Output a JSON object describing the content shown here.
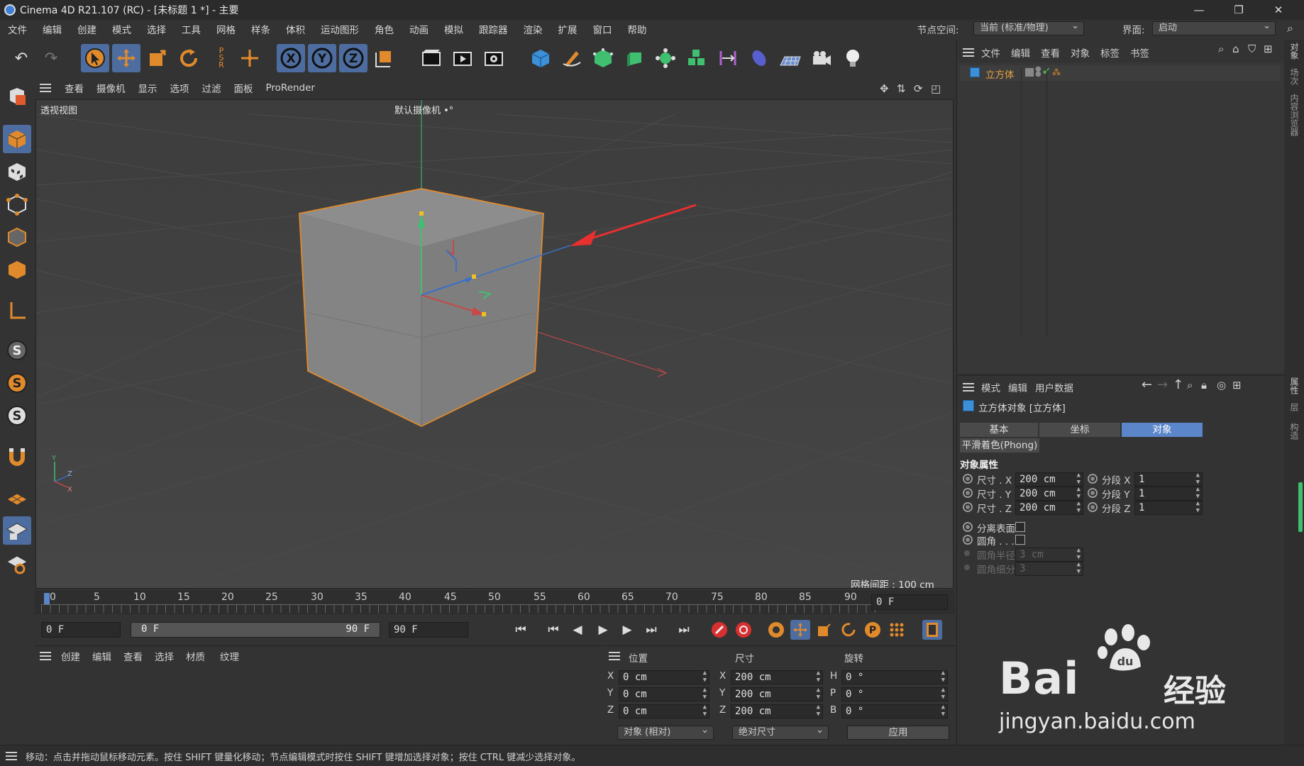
{
  "window": {
    "title": "Cinema 4D R21.107 (RC) - [未标题 1 *] - 主要",
    "minimize": "—",
    "restore": "❐",
    "close": "✕"
  },
  "menu": {
    "items": [
      "文件",
      "编辑",
      "创建",
      "模式",
      "选择",
      "工具",
      "网格",
      "样条",
      "体积",
      "运动图形",
      "角色",
      "动画",
      "模拟",
      "跟踪器",
      "渲染",
      "扩展",
      "窗口",
      "帮助"
    ]
  },
  "node_space": {
    "label": "节点空间:",
    "value": "当前 (标准/物理)"
  },
  "layout": {
    "label": "界面:",
    "value": "启动"
  },
  "viewport_menu": {
    "items": [
      "查看",
      "摄像机",
      "显示",
      "选项",
      "过滤",
      "面板",
      "ProRender"
    ]
  },
  "viewport": {
    "name": "透视视图",
    "camera": "默认摄像机 •°",
    "grid_spacing": "网格间距 : 100 cm"
  },
  "timeline": {
    "ticks": [
      "0",
      "5",
      "10",
      "15",
      "20",
      "25",
      "30",
      "35",
      "40",
      "45",
      "50",
      "55",
      "60",
      "65",
      "70",
      "75",
      "80",
      "85",
      "90"
    ],
    "current_frame": "0 F"
  },
  "transport": {
    "start": "0 F",
    "range_start": "0 F",
    "range_end": "90 F",
    "end": "90 F"
  },
  "materials": {
    "menu": [
      "创建",
      "编辑",
      "查看",
      "选择",
      "材质",
      "纹理"
    ]
  },
  "coords": {
    "headers": [
      "位置",
      "尺寸",
      "旋转"
    ],
    "rows": [
      {
        "axis": "X",
        "pos": "0 cm",
        "size_axis": "X",
        "size": "200 cm",
        "rot_axis": "H",
        "rot": "0 °"
      },
      {
        "axis": "Y",
        "pos": "0 cm",
        "size_axis": "Y",
        "size": "200 cm",
        "rot_axis": "P",
        "rot": "0 °"
      },
      {
        "axis": "Z",
        "pos": "0 cm",
        "size_axis": "Z",
        "size": "200 cm",
        "rot_axis": "B",
        "rot": "0 °"
      }
    ],
    "mode": "对象 (相对)",
    "size_mode": "绝对尺寸",
    "apply": "应用"
  },
  "object_manager": {
    "menu": [
      "文件",
      "编辑",
      "查看",
      "对象",
      "标签",
      "书签"
    ],
    "object": "立方体"
  },
  "attributes": {
    "menu": [
      "模式",
      "编辑",
      "用户数据"
    ],
    "title": "立方体对象 [立方体]",
    "tabs": [
      "基本",
      "坐标",
      "对象"
    ],
    "active_tab": "对象",
    "phong_tab": "平滑着色(Phong)",
    "section": "对象属性",
    "size_rows": [
      {
        "label": "尺寸 . X",
        "value": "200 cm",
        "seg_label": "分段 X",
        "seg": "1"
      },
      {
        "label": "尺寸 . Y",
        "value": "200 cm",
        "seg_label": "分段 Y",
        "seg": "1"
      },
      {
        "label": "尺寸 . Z",
        "value": "200 cm",
        "seg_label": "分段 Z",
        "seg": "1"
      }
    ],
    "separate_surfaces": "分离表面",
    "fillet": "圆角 . . .",
    "fillet_radius": {
      "label": "圆角半径",
      "value": "3 cm"
    },
    "fillet_subdiv": {
      "label": "圆角细分",
      "value": "3"
    }
  },
  "right_tabs": [
    "对象",
    "场次",
    "内容浏览器",
    "属性",
    "层",
    "构造"
  ],
  "status": "移动：点击并拖动鼠标移动元素。按住 SHIFT 键量化移动；节点编辑模式时按住 SHIFT 键增加选择对象；按住 CTRL 键减少选择对象。",
  "watermark": {
    "brand": "Bai",
    "cn": "经验",
    "url": "jingyan.baidu.com"
  },
  "colors": {
    "accent": "#4d6da0",
    "orange": "#e08a2c",
    "selection_blue": "#5b86c9"
  }
}
